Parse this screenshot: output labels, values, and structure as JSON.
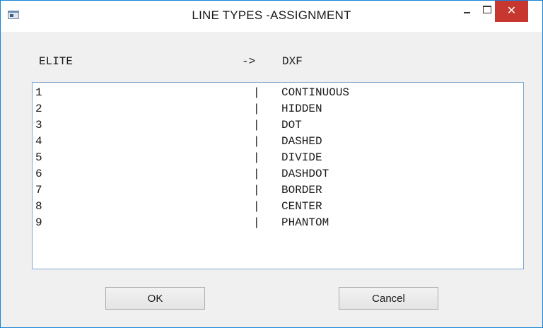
{
  "window": {
    "title": "LINE TYPES -ASSIGNMENT",
    "close_glyph": "✕",
    "accent_color": "#1883d7",
    "close_color": "#c7372f"
  },
  "header": {
    "left": "ELITE",
    "arrow": "->",
    "right": "DXF"
  },
  "list": {
    "separator": "|",
    "rows": [
      {
        "num": "1",
        "type": "CONTINUOUS"
      },
      {
        "num": "2",
        "type": "HIDDEN"
      },
      {
        "num": "3",
        "type": "DOT"
      },
      {
        "num": "4",
        "type": "DASHED"
      },
      {
        "num": "5",
        "type": "DIVIDE"
      },
      {
        "num": "6",
        "type": "DASHDOT"
      },
      {
        "num": "7",
        "type": "BORDER"
      },
      {
        "num": "8",
        "type": "CENTER"
      },
      {
        "num": "9",
        "type": "PHANTOM"
      }
    ]
  },
  "buttons": {
    "ok": "OK",
    "cancel": "Cancel"
  },
  "icons": {
    "app": "window-icon",
    "minimize": "minimize-icon",
    "maximize": "maximize-icon",
    "close": "close-icon"
  }
}
